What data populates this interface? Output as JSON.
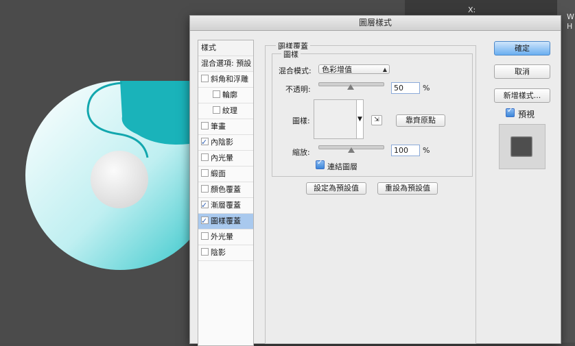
{
  "dialog": {
    "title": "圖層樣式",
    "style_list": {
      "header": "樣式",
      "blend_options": "混合選項: 預設",
      "items": [
        {
          "label": "斜角和浮雕",
          "checked": false,
          "indent": false
        },
        {
          "label": "輪廓",
          "checked": false,
          "indent": true
        },
        {
          "label": "紋理",
          "checked": false,
          "indent": true
        },
        {
          "label": "筆畫",
          "checked": false,
          "indent": false
        },
        {
          "label": "內陰影",
          "checked": true,
          "indent": false
        },
        {
          "label": "內光暈",
          "checked": false,
          "indent": false
        },
        {
          "label": "緞面",
          "checked": false,
          "indent": false
        },
        {
          "label": "顏色覆蓋",
          "checked": false,
          "indent": false
        },
        {
          "label": "漸層覆蓋",
          "checked": true,
          "indent": false
        },
        {
          "label": "圖樣覆蓋",
          "checked": true,
          "indent": false,
          "selected": true
        },
        {
          "label": "外光暈",
          "checked": false,
          "indent": false
        },
        {
          "label": "陰影",
          "checked": false,
          "indent": false
        }
      ]
    },
    "panel": {
      "section_title": "圖樣覆蓋",
      "sub_title": "圖樣",
      "blend_mode_label": "混合模式:",
      "blend_mode_value": "色彩增值",
      "opacity_label": "不透明:",
      "opacity_value": "50",
      "opacity_fraction": 0.5,
      "percent_sign": "%",
      "pattern_label": "圖樣:",
      "snap_origin_button": "靠齊原點",
      "scale_label": "縮放:",
      "scale_value": "100",
      "link_layer_label": "連結圖層",
      "link_layer_checked": true,
      "make_default_button": "設定為預設值",
      "reset_default_button": "重設為預設值"
    },
    "buttons": {
      "ok": "確定",
      "cancel": "取消",
      "new_style": "新增樣式...",
      "preview_label": "預視",
      "preview_checked": true
    }
  },
  "background": {
    "right_panel_text_1": "W",
    "right_panel_text_2": "H",
    "top_panel_text": "X:"
  },
  "colors": {
    "accent_teal": "#1ab3ba",
    "selection_blue": "#a9c9ee",
    "canvas_gray": "#4b4b4b"
  }
}
